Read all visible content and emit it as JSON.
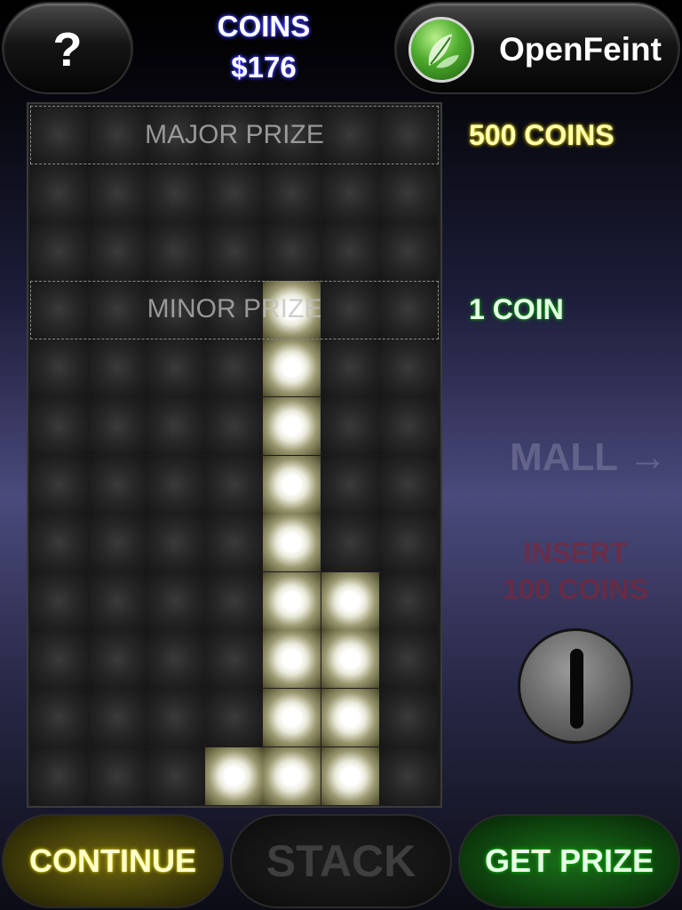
{
  "header": {
    "help_label": "?",
    "coins_label": "COINS",
    "coins_value": "$176",
    "openfeint_label": "OpenFeint",
    "openfeint_icon": "leaf-icon"
  },
  "board": {
    "columns": 7,
    "rows": 12,
    "major_zone_label": "MAJOR PRIZE",
    "minor_zone_label": "MINOR PRIZE",
    "lit_cells": [
      {
        "row": 3,
        "col": 4
      },
      {
        "row": 4,
        "col": 4
      },
      {
        "row": 5,
        "col": 4
      },
      {
        "row": 6,
        "col": 4
      },
      {
        "row": 7,
        "col": 4
      },
      {
        "row": 8,
        "col": 4
      },
      {
        "row": 8,
        "col": 5
      },
      {
        "row": 9,
        "col": 4
      },
      {
        "row": 9,
        "col": 5
      },
      {
        "row": 10,
        "col": 4
      },
      {
        "row": 10,
        "col": 5
      },
      {
        "row": 11,
        "col": 3
      },
      {
        "row": 11,
        "col": 4
      },
      {
        "row": 11,
        "col": 5
      }
    ]
  },
  "side": {
    "major_prize_value": "500 COINS",
    "minor_prize_value": "1 COIN",
    "mall_label": "MALL →",
    "insert_line1": "INSERT",
    "insert_line2": "100 COINS"
  },
  "buttons": {
    "continue_label": "CONTINUE",
    "stack_label": "STACK",
    "get_prize_label": "GET PRIZE"
  },
  "colors": {
    "major_glow": "#d8c800",
    "minor_glow": "#10b010",
    "coins_glow": "#4a4aff"
  }
}
